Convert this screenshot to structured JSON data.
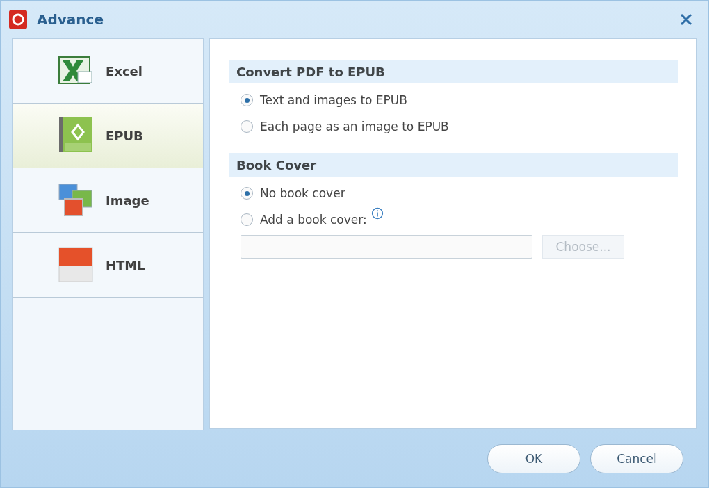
{
  "window": {
    "title": "Advance"
  },
  "sidebar": {
    "items": [
      {
        "label": "Excel",
        "kind": "excel",
        "selected": false
      },
      {
        "label": "EPUB",
        "kind": "epub",
        "selected": true
      },
      {
        "label": "Image",
        "kind": "image",
        "selected": false
      },
      {
        "label": "HTML",
        "kind": "html",
        "selected": false
      }
    ]
  },
  "sections": [
    {
      "title": "Convert PDF to EPUB",
      "options": [
        {
          "label": "Text and images to EPUB",
          "selected": true
        },
        {
          "label": "Each page as an image to EPUB",
          "selected": false
        }
      ]
    },
    {
      "title": "Book Cover",
      "options": [
        {
          "label": "No book cover",
          "selected": true,
          "info": false
        },
        {
          "label": "Add a book cover:",
          "selected": false,
          "info": true
        }
      ],
      "file_picker": {
        "button": "Choose...",
        "disabled": true
      }
    }
  ],
  "buttons": [
    "OK",
    "Cancel"
  ]
}
